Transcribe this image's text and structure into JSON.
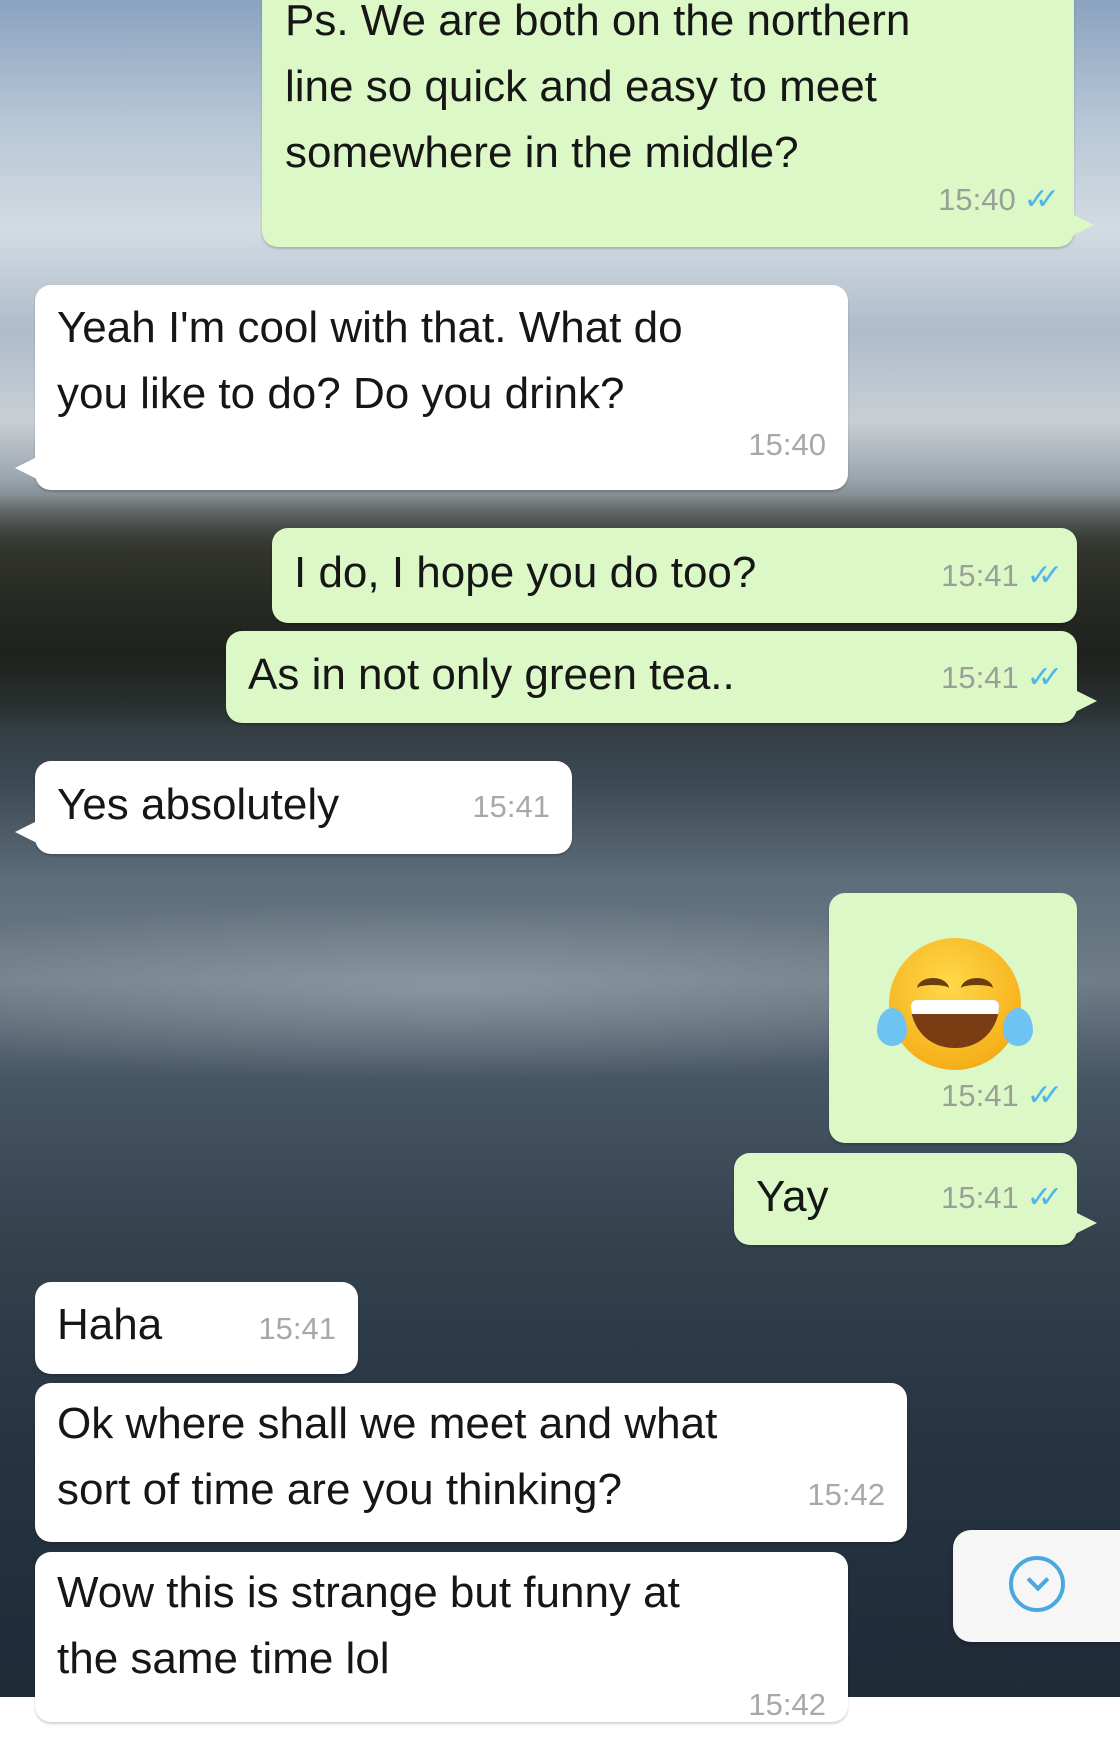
{
  "colors": {
    "outgoing_bubble": "#dcf8c6",
    "incoming_bubble": "#ffffff",
    "read_ticks": "#4fb6ec",
    "scroll_button_accent": "#4aa8e0"
  },
  "messages": [
    {
      "direction": "outgoing",
      "lines": [
        "Ps. We are both on the northern",
        "line so quick and easy to meet",
        "somewhere in the middle?"
      ],
      "time": "15:40",
      "status": "read-ticks-icon"
    },
    {
      "direction": "incoming",
      "lines": [
        "Yeah I'm cool with that. What do",
        "you like to do? Do you drink?"
      ],
      "time": "15:40"
    },
    {
      "direction": "outgoing",
      "lines": [
        "I do, I hope you do too?"
      ],
      "time": "15:41",
      "status": "read-ticks-icon"
    },
    {
      "direction": "outgoing",
      "lines": [
        "As in not only green tea.."
      ],
      "time": "15:41",
      "status": "read-ticks-icon"
    },
    {
      "direction": "incoming",
      "lines": [
        "Yes absolutely"
      ],
      "time": "15:41"
    },
    {
      "direction": "outgoing",
      "emoji": "face-with-tears-of-joy-icon",
      "time": "15:41",
      "status": "read-ticks-icon"
    },
    {
      "direction": "outgoing",
      "lines": [
        "Yay"
      ],
      "time": "15:41",
      "status": "read-ticks-icon"
    },
    {
      "direction": "incoming",
      "lines": [
        "Haha"
      ],
      "time": "15:41"
    },
    {
      "direction": "incoming",
      "lines": [
        "Ok where shall we meet and what",
        "sort of time are you thinking?"
      ],
      "time": "15:42"
    },
    {
      "direction": "incoming",
      "lines": [
        "Wow this is strange but funny at",
        "the same time lol"
      ],
      "time": "15:42"
    }
  ],
  "scroll_button": {
    "icon": "chevron-down-circle-icon"
  }
}
